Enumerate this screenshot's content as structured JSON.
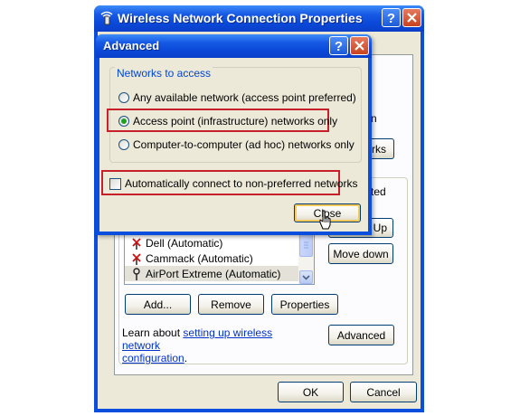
{
  "parent_window": {
    "title": "Wireless Network Connection Properties",
    "partial_texts": {
      "right_n": "n",
      "right_rks": "rks",
      "right_ted": "ted"
    },
    "networks": [
      {
        "label": "Dell (Automatic)",
        "icon": "antenna-icon"
      },
      {
        "label": "Cammack (Automatic)",
        "icon": "antenna-icon"
      },
      {
        "label": "AirPort Extreme (Automatic)",
        "icon": "wireless-network-icon",
        "selected": true
      }
    ],
    "buttons": {
      "move_up": "Up",
      "move_down": "Move down",
      "add": "Add...",
      "remove": "Remove",
      "properties": "Properties",
      "advanced": "Advanced",
      "ok": "OK",
      "cancel": "Cancel"
    },
    "learn_about": {
      "prefix": "Learn about ",
      "link_line1": "setting up wireless network",
      "link_line2": "configuration",
      "suffix": "."
    }
  },
  "advanced_dialog": {
    "title": "Advanced",
    "group_title": "Networks to access",
    "options": [
      {
        "label": "Any available network (access point preferred)",
        "selected": false
      },
      {
        "label": "Access point (infrastructure) networks only",
        "selected": true
      },
      {
        "label": "Computer-to-computer (ad hoc) networks only",
        "selected": false
      }
    ],
    "auto_connect": {
      "label": "Automatically connect to non-preferred networks",
      "checked": false
    },
    "close_button": "Close"
  },
  "colors": {
    "title_blue": "#0A4EDE",
    "highlight_red": "#C8202A",
    "group_title_blue": "#0046D5",
    "dialog_face": "#ECE9D8"
  }
}
